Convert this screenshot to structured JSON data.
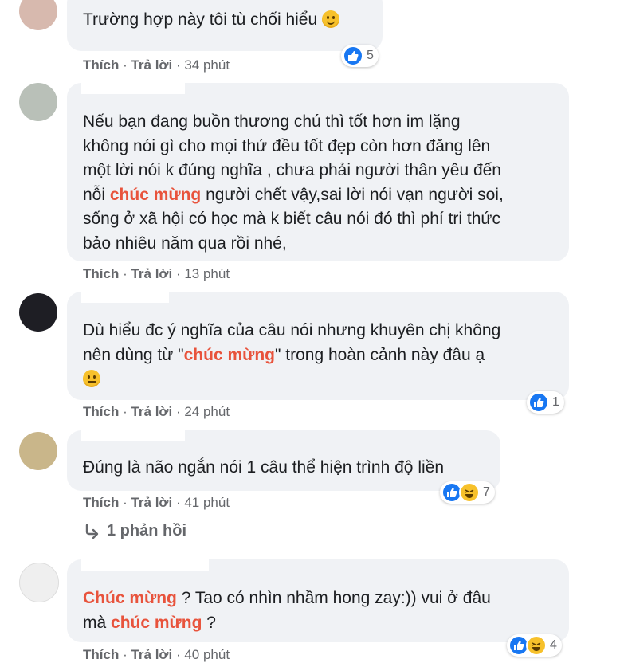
{
  "comments": [
    {
      "lines": [
        "Trường hợp này tôi tù chối hiểu"
      ],
      "actions": {
        "like": "Thích",
        "reply": "Trả lời",
        "time": "34 phút"
      },
      "reaction_count": "5"
    },
    {
      "lines": [
        "Nếu bạn đang buồn thương chú thì tốt hơn im lặng",
        "không nói gì cho mọi thứ đều tốt đẹp còn hơn đăng lên",
        "một lời nói k đúng nghĩa , chưa phải người thân yêu đến",
        "nỗi ",
        "chúc mừng",
        " người chết vậy,sai lời nói vạn người soi,",
        "sống ở xã hội có học mà k biết câu nói đó thì phí tri thức",
        "bảo nhiêu năm qua rồi nhé,"
      ],
      "actions": {
        "like": "Thích",
        "reply": "Trả lời",
        "time": "13 phút"
      }
    },
    {
      "lines": [
        "Dù hiểu đc ý nghĩa của câu nói nhưng khuyên chị không",
        "nên dùng từ \"",
        "chúc mừng",
        "\" trong hoàn cảnh này đâu ạ"
      ],
      "actions": {
        "like": "Thích",
        "reply": "Trả lời",
        "time": "24 phút"
      },
      "reaction_count": "1"
    },
    {
      "lines": [
        "Đúng là não ngắn nói 1 câu thể hiện trình độ liền"
      ],
      "actions": {
        "like": "Thích",
        "reply": "Trả lời",
        "time": "41 phút"
      },
      "reaction_count": "7",
      "replies_label": "1 phản hồi"
    },
    {
      "lines": [
        "Chúc mừng",
        " ? Tao có nhìn nhầm hong zay:)) vui ở đâu",
        "mà ",
        "chúc mừng",
        " ?"
      ],
      "actions": {
        "like": "Thích",
        "reply": "Trả lời",
        "time": "40 phút"
      },
      "reaction_count": "4"
    }
  ],
  "sep": " · ",
  "colors": {
    "highlight": "#e8533c",
    "bubble": "#f0f2f5",
    "meta": "#65676b",
    "like": "#1877f2"
  },
  "icons": [
    "like-icon",
    "haha-icon",
    "smile-emoji-icon",
    "neutral-emoji-icon",
    "reply-arrow-icon"
  ]
}
